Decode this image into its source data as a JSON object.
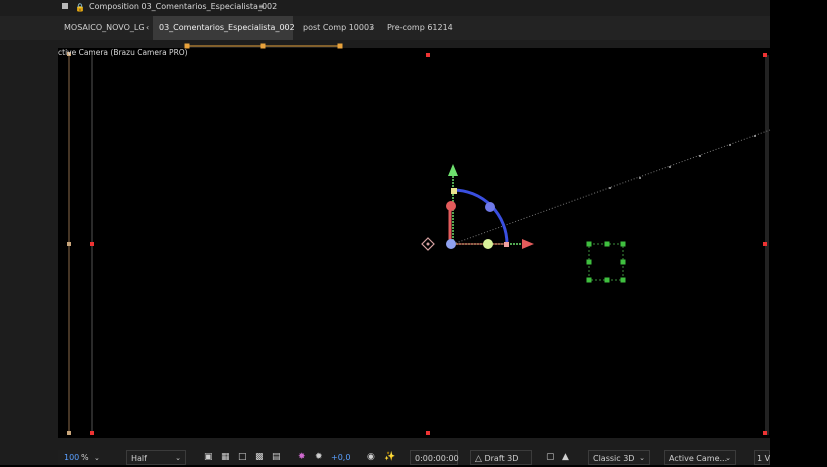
{
  "titlebar": {
    "title": "Composition 03_Comentarios_Especialista_002",
    "menu_icon": "hamburger-icon"
  },
  "tabs": [
    {
      "label": "MOSAICO_NOVO_LG"
    },
    {
      "label": "03_Comentarios_Especialista_002",
      "active": true
    },
    {
      "label": "post Comp 10003"
    },
    {
      "label": "Pre-comp 61214"
    }
  ],
  "viewer": {
    "camera_label": "ctive Camera (Brazu Camera PRO)"
  },
  "bottombar": {
    "zoom_value": "100",
    "zoom_unit": "%",
    "resolution": "Half",
    "exposure": "+0,0",
    "timecode": "0:00:00:00",
    "draft3d": "Draft 3D",
    "renderer": "Classic 3D",
    "view": "Active Came...",
    "views_count": "1 V"
  },
  "colors": {
    "accent_blue": "#5aa0ff",
    "handle_orange": "#e8a23c",
    "axis_red": "#e35b5b",
    "axis_green": "#6ee06e",
    "axis_blue": "#3a4fe0"
  }
}
